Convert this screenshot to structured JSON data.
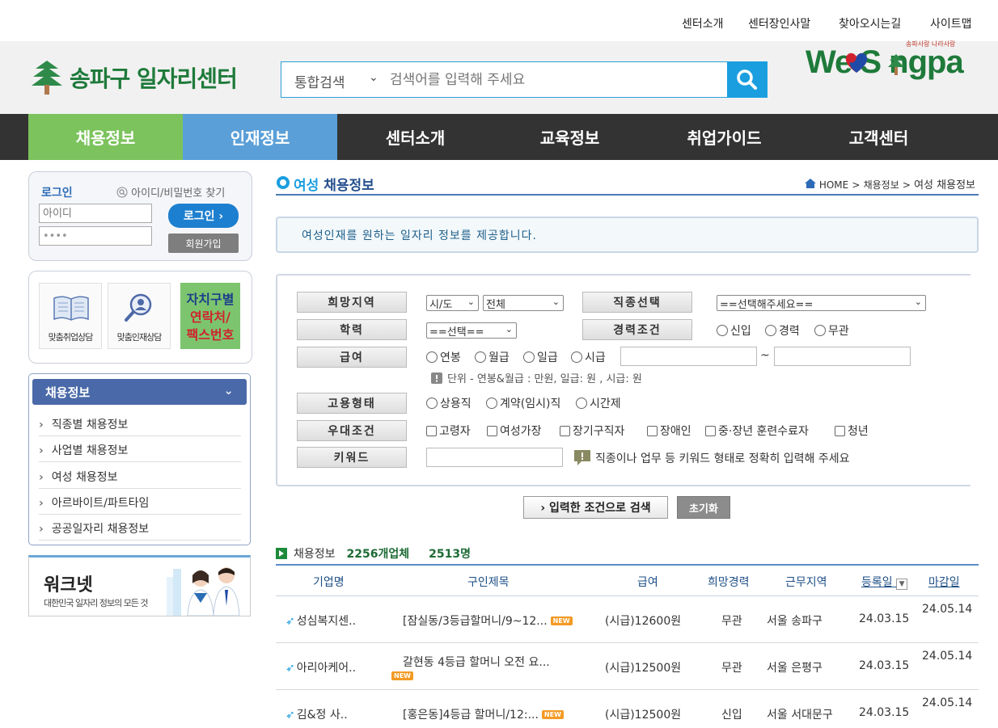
{
  "util_links": [
    "센터소개",
    "센터장인사말",
    "찾아오시는길",
    "사이트맵"
  ],
  "logo": {
    "name": "송파구 일자리센터"
  },
  "search": {
    "scope": "통합검색",
    "placeholder": "검색어를 입력해 주세요"
  },
  "brand": {
    "small": "송파사랑 나라사랑",
    "big": "We S ngpa"
  },
  "gnb": [
    "채용정보",
    "인재정보",
    "센터소개",
    "교육정보",
    "취업가이드",
    "고객센터"
  ],
  "colors": {
    "gnb_active": "#7cc35d",
    "gnb_hover": "#5a9fd8",
    "gnb_bg": "#333333",
    "accent": "#1a9ee0"
  },
  "login": {
    "title": "로그인",
    "find": "아이디/비밀번호 찾기",
    "id_placeholder": "아이디",
    "pw_value": "••••",
    "login_btn": "로그인 ›",
    "join_btn": "회원가입"
  },
  "quick": {
    "item1": "맞춤취업상담",
    "item2": "맞춤인재상담",
    "green_line1": "자치구별",
    "green_line2": "연락처/",
    "green_line3": "팩스번호"
  },
  "side_menu": {
    "title": "채용정보",
    "items": [
      "직종별 채용정보",
      "사업별 채용정보",
      "여성 채용정보",
      "아르바이트/파트타임",
      "공공일자리 채용정보"
    ]
  },
  "banner": {
    "title": "워크넷",
    "subtitle": "대한민국 일자리 정보의 모든 것"
  },
  "page": {
    "title_a": "여성",
    "title_b": " 채용정보",
    "crumb_home": "HOME",
    "crumb_1": "채용정보",
    "crumb_2": "여성 채용정보"
  },
  "notice": "여성인재를 원하는 일자리 정보를 제공합니다.",
  "filter": {
    "region_label": "희망지역",
    "region_sido": "시/도",
    "region_all": "전체",
    "job_label": "직종선택",
    "job_value": "==선택해주세요==",
    "edu_label": "학력",
    "edu_value": "==선택==",
    "career_label": "경력조건",
    "career_opts": [
      "신입",
      "경력",
      "무관"
    ],
    "pay_label": "급여",
    "pay_opts": [
      "연봉",
      "월급",
      "일급",
      "시급"
    ],
    "pay_tilde": "~",
    "pay_note": "단위 - 연봉&월급 : 만원, 일급: 원 , 시급: 원",
    "emp_label": "고용형태",
    "emp_opts": [
      "상용직",
      "계약(임시)직",
      "시간제"
    ],
    "pref_label": "우대조건",
    "pref_opts": [
      "고령자",
      "여성가장",
      "장기구직자",
      "장애인",
      "중·장년 훈련수료자",
      "청년"
    ],
    "kw_label": "키워드",
    "kw_note": "직종이나 업무 등 키워드 형태로 정확히 입력해 주세요"
  },
  "buttons": {
    "search": "› 입력한 조건으로 검색",
    "reset": "초기화"
  },
  "summary": {
    "label": "채용정보",
    "companies": "2256개업체",
    "people": "2513명"
  },
  "table": {
    "headers": [
      "기업명",
      "구인제목",
      "급여",
      "희망경력",
      "근무지역",
      "등록일",
      "마감일"
    ],
    "rows": [
      {
        "company": "성심복지센..",
        "title": "[잠실동/3등급할머니/9~12...",
        "new": "NEW",
        "pay": "(시급)12600원",
        "career": "무관",
        "region": "서울 송파구",
        "reg": "24.03.15",
        "due": "24.05.14"
      },
      {
        "company": "아리아케어..",
        "title": "갈현동 4등급 할머니 오전 요...",
        "new": "NEW",
        "pay": "(시급)12500원",
        "career": "무관",
        "region": "서울 은평구",
        "reg": "24.03.15",
        "due": "24.05.14"
      },
      {
        "company": "김&정 사..",
        "title": "[홍은동]4등급 할머니/12:...",
        "new": "NEW",
        "pay": "(시급)12500원",
        "career": "신입",
        "region": "서울 서대문구",
        "reg": "24.03.15",
        "due": "24.05.14"
      }
    ]
  }
}
